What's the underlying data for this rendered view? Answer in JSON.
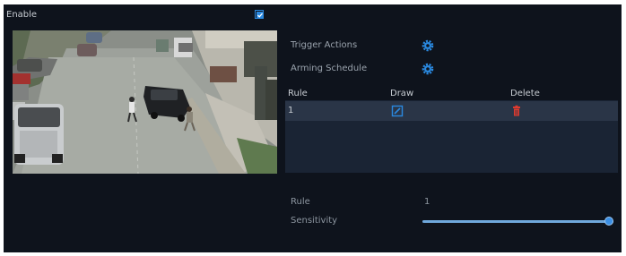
{
  "enable": {
    "label": "Enable",
    "checked": true
  },
  "camera": {
    "feed": "live-preview"
  },
  "settings": {
    "trigger_actions": {
      "label": "Trigger Actions",
      "icon": "gear-icon"
    },
    "arming_schedule": {
      "label": "Arming Schedule",
      "icon": "gear-icon"
    }
  },
  "rule_table": {
    "headers": {
      "rule": "Rule",
      "draw": "Draw",
      "delete": "Delete"
    },
    "rows": [
      {
        "rule": "1",
        "draw_icon": "edit-icon",
        "delete_icon": "trash-icon"
      }
    ]
  },
  "detail": {
    "rule_label": "Rule",
    "rule_value": "1",
    "sensitivity_label": "Sensitivity",
    "sensitivity_fraction": 1.0
  },
  "colors": {
    "accent": "#2a89e0",
    "panel_bg": "#0e131c",
    "table_bg": "#1a2434",
    "row_selected": "#2a3547",
    "delete_red": "#e03a2e"
  }
}
